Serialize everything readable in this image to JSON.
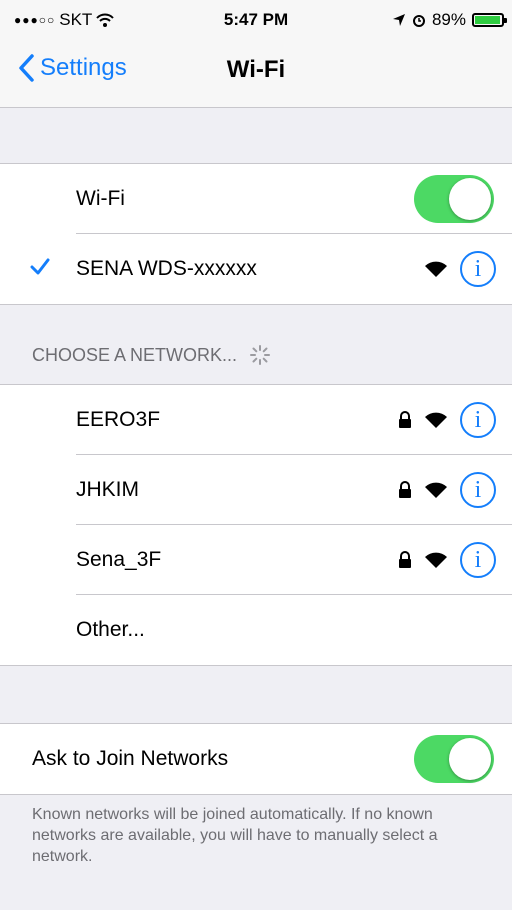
{
  "status_bar": {
    "carrier": "SKT",
    "time": "5:47 PM",
    "battery": "89%",
    "battery_level": 0.89
  },
  "nav": {
    "back_label": "Settings",
    "title": "Wi-Fi"
  },
  "wifi_toggle": {
    "label": "Wi-Fi",
    "on": true
  },
  "connected_network": {
    "name": "SENA WDS-xxxxxx"
  },
  "networks_header": "CHOOSE A NETWORK...",
  "networks": [
    {
      "name": "EERO3F",
      "locked": true
    },
    {
      "name": "JHKIM",
      "locked": true
    },
    {
      "name": "Sena_3F",
      "locked": true
    }
  ],
  "other_label": "Other...",
  "ask_to_join": {
    "label": "Ask to Join Networks",
    "on": true
  },
  "footer": "Known networks will be joined automatically. If no known networks are available, you will have to manually select a network.",
  "colors": {
    "accent": "#147efb",
    "toggle_on": "#4cd964",
    "background": "#efeff4"
  },
  "icons": [
    "wifi-signal-icon",
    "cellular-signal-icon",
    "location-arrow-icon",
    "alarm-icon",
    "battery-icon",
    "chevron-left-icon",
    "checkmark-icon",
    "lock-icon",
    "info-icon",
    "spinner-icon"
  ]
}
